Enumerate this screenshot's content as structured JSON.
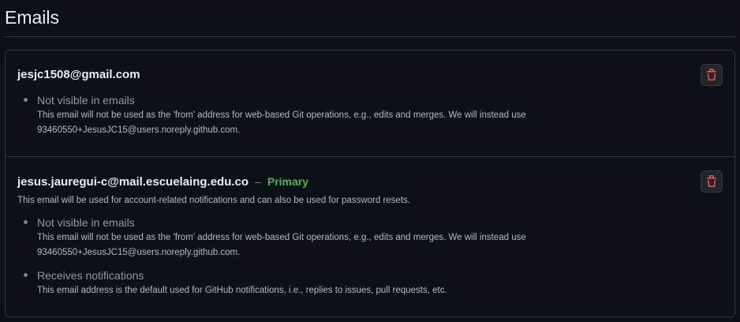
{
  "header": {
    "title": "Emails"
  },
  "emails": [
    {
      "address": "jesjc1508@gmail.com",
      "bullets": [
        {
          "title": "Not visible in emails",
          "note": "This email will not be used as the 'from' address for web-based Git operations, e.g., edits and merges. We will instead use 93460550+JesusJC15@users.noreply.github.com."
        }
      ],
      "delete_icon": "trash-icon"
    },
    {
      "address": "jesus.jauregui-c@mail.escuelaing.edu.co",
      "separator": "–",
      "badge": "Primary",
      "description": "This email will be used for account-related notifications and can also be used for password resets.",
      "bullets": [
        {
          "title": "Not visible in emails",
          "note": "This email will not be used as the 'from' address for web-based Git operations, e.g., edits and merges. We will instead use 93460550+JesusJC15@users.noreply.github.com."
        },
        {
          "title": "Receives notifications",
          "note": "This email address is the default used for GitHub notifications, i.e., replies to issues, pull requests, etc."
        }
      ],
      "delete_icon": "trash-icon"
    }
  ],
  "colors": {
    "background": "#0d1117",
    "border": "#30363d",
    "primary_badge": "#3fb950",
    "delete_icon": "#f85149"
  }
}
